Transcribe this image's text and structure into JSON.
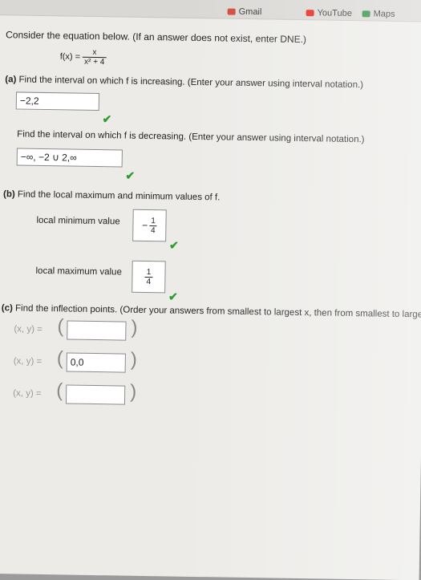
{
  "bookmarks": [
    {
      "label": "Gmail",
      "icon": "gmail-icon",
      "color": "#d44638"
    },
    {
      "label": "YouTube",
      "icon": "youtube-icon",
      "color": "#e62117"
    },
    {
      "label": "Maps",
      "icon": "maps-icon",
      "color": "#2a8a3f"
    }
  ],
  "intro": "Consider the equation below. (If an answer does not exist, enter DNE.)",
  "function": {
    "lhs": "f(x) =",
    "numerator": "x",
    "denominator": "x² + 4"
  },
  "part_a": {
    "label": "(a)",
    "question": "Find the interval on which f is increasing. (Enter your answer using interval notation.)",
    "answer": "−2,2",
    "question2": "Find the interval on which f is decreasing. (Enter your answer using interval notation.)",
    "answer2": "−∞, −2 ∪ 2,∞"
  },
  "part_b": {
    "label": "(b)",
    "question": "Find the local maximum and minimum values of f.",
    "min_label": "local minimum value",
    "min_sign": "−",
    "min_num": "1",
    "min_den": "4",
    "max_label": "local maximum value",
    "max_num": "1",
    "max_den": "4"
  },
  "part_c": {
    "label": "(c)",
    "question": "Find the inflection points. (Order your answers from smallest to largest x, then from smallest to largest y.)",
    "point_label": "(x, y) =",
    "points": [
      "",
      "0,0",
      ""
    ]
  },
  "check_mark": "✔",
  "colors": {
    "correct": "#2e9b2e",
    "link": "#2b4c8c"
  }
}
